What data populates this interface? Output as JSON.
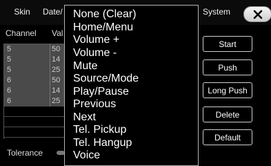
{
  "tabs": {
    "skin": "Skin",
    "date": "Date/",
    "system": "System"
  },
  "close_icon": "close-icon",
  "columns": {
    "channel": "Channel",
    "value": "Val"
  },
  "rows": [
    {
      "channel": "5",
      "value": "50"
    },
    {
      "channel": "5",
      "value": "14"
    },
    {
      "channel": "5",
      "value": "25"
    },
    {
      "channel": "6",
      "value": "50"
    },
    {
      "channel": "6",
      "value": "14"
    },
    {
      "channel": "6",
      "value": "25"
    }
  ],
  "tolerance_label": "Tolerance",
  "dropdown": {
    "options": [
      "None (Clear)",
      "Home/Menu",
      "Volume +",
      "Volume -",
      "Mute",
      "Source/Mode",
      "Play/Pause",
      "Previous",
      "Next",
      "Tel. Pickup",
      "Tel. Hangup",
      "Voice"
    ]
  },
  "buttons": {
    "start": "Start",
    "push": "Push",
    "long_push": "Long Push",
    "delete": "Delete",
    "default": "Default"
  }
}
